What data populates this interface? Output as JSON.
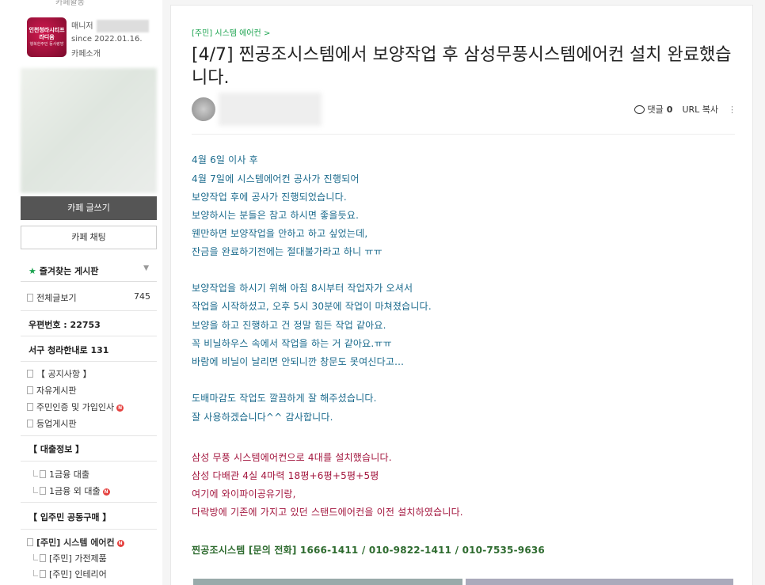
{
  "sidebar": {
    "top_label": "카페활동",
    "manager_label": "매니저",
    "since": "since 2022.01.16.",
    "intro": "카페소개",
    "logo_text": "인천청라시티프라디움",
    "logo_sub": "행복한주민 동사랑방",
    "write_button": "카페 글쓰기",
    "chat_button": "카페 채팅",
    "favorites_label": "즐겨찾는 게시판",
    "all_posts_label": "전체글보기",
    "all_posts_count": "745",
    "zip_code": "우편번호 : 22753",
    "address": "서구 청라한내로 131",
    "menu_group1": [
      "【 공지사항 】",
      "자유게시판",
      "주민인증 및 가입인사",
      "등업게시판"
    ],
    "loan_header": "【 대출정보 】",
    "loan_items": [
      "1금융 대출",
      "1금융 외 대출"
    ],
    "buy_header": "【 입주민 공동구매 】",
    "buy_items": [
      "[주민] 시스템 에어컨",
      "[주민] 가전제품",
      "[주민] 인테리어"
    ],
    "accent_color": "#1ba34f"
  },
  "article": {
    "breadcrumb": "[주민] 시스템 에어컨 >",
    "title": "[4/7] 찐공조시스템에서 보양작업 후 삼성무풍시스템에어컨 설치 완료했습니다.",
    "comment_label": "댓글",
    "comment_count": "0",
    "url_copy": "URL 복사",
    "body_blue_1": [
      "4월 6일 이사 후",
      "4월 7일에 시스템에어컨 공사가 진행되어",
      "보양작업 후에 공사가 진행되었습니다.",
      "보양하시는 분들은 참고 하시면 좋을듯요.",
      "웬만하면 보양작업을 안하고 하고 싶었는데,",
      "잔금을 완료하기전에는 절대불가라고 하니 ㅠㅠ"
    ],
    "body_blue_2": [
      "보양작업을 하시기 위해 아침 8시부터 작업자가 오셔서",
      "작업을 시작하셨고, 오후 5시 30분에 작업이 마쳐졌습니다.",
      "보양을 하고 진행하고 건 정말 힘든 작업 같아요.",
      "꼭 비닐하우스 속에서 작업을 하는 거 같아요.ㅠㅠ",
      "바람에 비닐이 날리면 안되니깐 창문도 못여신다고..."
    ],
    "body_blue_3": [
      "도배마감도 작업도 깔끔하게 잘 해주셨습니다.",
      "잘 사용하겠습니다^^ 감사합니다."
    ],
    "body_red": [
      "삼성 무풍 시스템에어컨으로 4대를 설치했습니다.",
      "삼성 다배관 4실 4마력 18평+6평+5평+5평",
      "여기에 와이파이공유기랑,",
      "다락방에 기존에 가지고 있던 스탠드에어컨을 이전 설치하였습니다."
    ],
    "contact": "찐공조시스템  [문의 전화]  1666-1411 / 010-9822-1411 / 010-7535-9636"
  }
}
